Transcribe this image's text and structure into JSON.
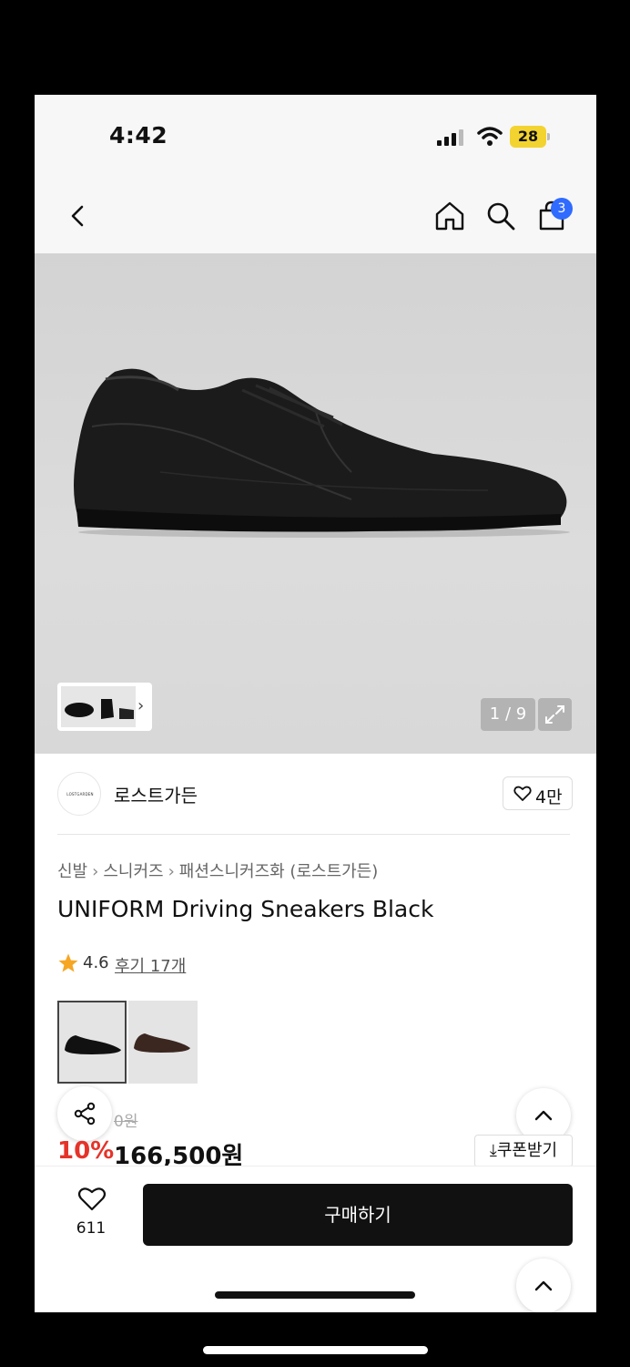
{
  "status_bar": {
    "time": "4:42",
    "battery": "28"
  },
  "nav": {
    "cart_count": "3"
  },
  "gallery": {
    "counter": "1 / 9"
  },
  "brand": {
    "name": "로스트가든",
    "logo_text": "LOSTGARDEN",
    "likes": "4만"
  },
  "breadcrumb": [
    "신발",
    "스니커즈",
    "패션스니커즈화 (로스트가든)"
  ],
  "product": {
    "title": "UNIFORM Driving Sneakers Black",
    "rating": "4.6",
    "reviews": "후기 17개"
  },
  "pricing": {
    "original": "0원",
    "discount": "10%",
    "price": "166,500원",
    "coupon": "쿠폰받기"
  },
  "bottom": {
    "wish_count": "611",
    "buy_label": "구매하기"
  },
  "colors": {
    "accent_red": "#e5332a",
    "badge_blue": "#2f6bff",
    "battery_yellow": "#f3d330"
  }
}
